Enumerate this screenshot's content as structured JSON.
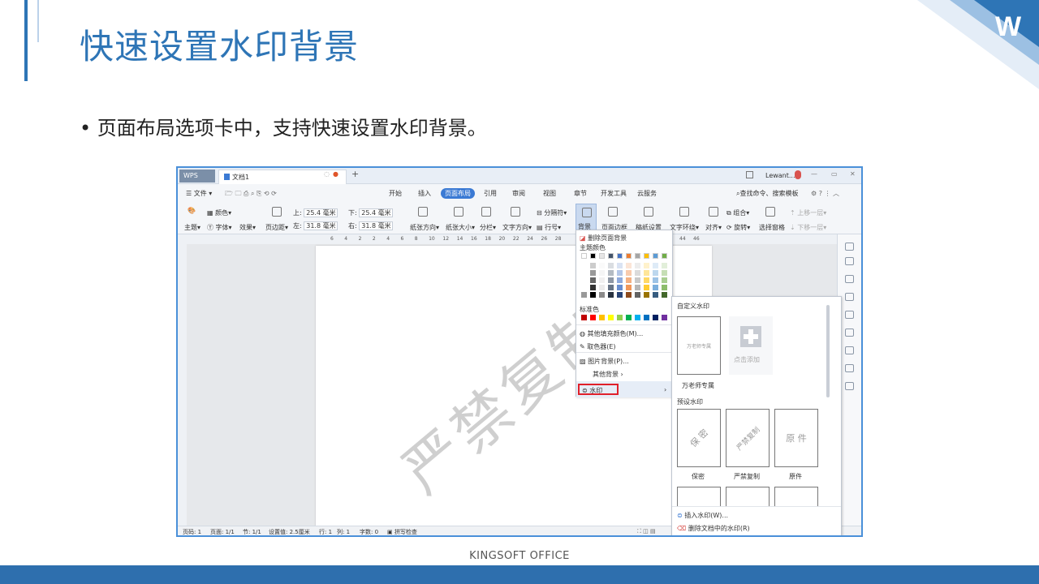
{
  "slide": {
    "title": "快速设置水印背景",
    "bullet": "页面布局选项卡中，支持快速设置水印背景。",
    "footer_brand": "KINGSOFT  OFFICE",
    "accent": "#2e75b6"
  },
  "app": {
    "wps_tab": "WPS",
    "doc_tab": "文档1",
    "user": "Lewant...",
    "menu": [
      "文件",
      "开始",
      "插入",
      "页面布局",
      "引用",
      "审阅",
      "视图",
      "章节",
      "开发工具",
      "云服务"
    ],
    "active_menu": "页面布局",
    "search_text": "查找命令、搜索模板",
    "ribbon": {
      "theme": "主题",
      "colors": "颜色",
      "font": "字体",
      "effects": "效果",
      "margins": "页边距",
      "top_label": "上:",
      "top_value": "25.4 毫米",
      "bottom_label": "下:",
      "bottom_value": "25.4 毫米",
      "left_label": "左:",
      "left_value": "31.8 毫米",
      "right_label": "右:",
      "right_value": "31.8 毫米",
      "orientation": "纸张方向",
      "size": "纸张大小",
      "columns": "分栏",
      "text_dir": "文字方向",
      "line_no": "行号",
      "breaks": "分隔符",
      "background": "背景",
      "page_border": "页面边框",
      "draft": "稿纸设置",
      "wrap": "文字环绕",
      "align": "对齐",
      "group": "组合",
      "rotate": "旋转",
      "select_pane": "选择窗格",
      "up_one": "上移一层",
      "down_one": "下移一层"
    },
    "ruler_ticks": [
      "6",
      "4",
      "2",
      "2",
      "4",
      "6",
      "8",
      "10",
      "12",
      "14",
      "16",
      "18",
      "20",
      "22",
      "24",
      "26",
      "28",
      "44",
      "46"
    ],
    "watermark_text": "严禁复制",
    "status": [
      "页码: 1",
      "页面: 1/1",
      "节: 1/1",
      "设置值: 2.5厘米",
      "行: 1",
      "列: 1",
      "字数: 0",
      "拼写检查"
    ],
    "bg_menu": {
      "remove_bg": "删除页面背景",
      "theme_colors": "主题颜色",
      "std_colors": "标准色",
      "more_fill": "其他填充颜色(M)...",
      "picker": "取色器(E)",
      "picture_bg": "图片背景(P)...",
      "other_bg": "其他背景",
      "watermark": "水印"
    },
    "theme_palette": [
      "#ffffff",
      "#000000",
      "#e7e6e6",
      "#44546a",
      "#4472c4",
      "#ed7d31",
      "#a5a5a5",
      "#ffc000",
      "#5b9bd5",
      "#70ad47"
    ],
    "std_palette": [
      "#c00000",
      "#ff0000",
      "#ffc000",
      "#ffff00",
      "#92d050",
      "#00b050",
      "#00b0f0",
      "#0070c0",
      "#002060",
      "#7030a0"
    ],
    "wm_menu": {
      "custom_header": "自定义水印",
      "custom_card": "万老师专属",
      "custom_name": "万老师专属",
      "add_label": "点击添加",
      "preset_header": "预设水印",
      "presets": [
        {
          "text": "保 密",
          "name": "保密"
        },
        {
          "text": "严禁复制",
          "name": "严禁复制"
        },
        {
          "text": "原 件",
          "name": "原件"
        }
      ],
      "insert": "插入水印(W)...",
      "remove": "删除文档中的水印(R)"
    }
  }
}
